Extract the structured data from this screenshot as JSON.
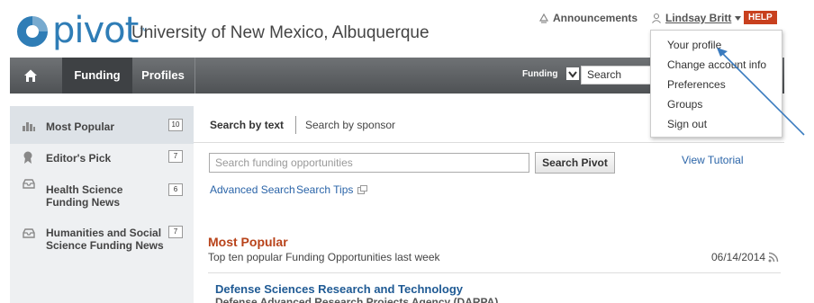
{
  "header": {
    "logo_text": "pivot",
    "logo_tm": "™",
    "institution": "University of New Mexico, Albuquerque",
    "announcements": "Announcements",
    "user_name": "Lindsay Britt",
    "help": "HELP"
  },
  "nav": {
    "tabs": [
      "Funding",
      "Profiles"
    ],
    "search_scope": "Funding",
    "search_placeholder": "Search"
  },
  "user_menu": {
    "items": [
      "Your profile",
      "Change account info",
      "Preferences",
      "Groups",
      "Sign out"
    ]
  },
  "sidebar": {
    "items": [
      {
        "label": "Most Popular",
        "count": "10"
      },
      {
        "label": "Editor's Pick",
        "count": "7"
      },
      {
        "label": "Health Science Funding News",
        "count": "6"
      },
      {
        "label": "Humanities and Social Science Funding News",
        "count": "7"
      }
    ]
  },
  "main": {
    "tab_search_text": "Search by text",
    "tab_search_sponsor": "Search by sponsor",
    "search_placeholder": "Search funding opportunities",
    "search_button": "Search Pivot",
    "advanced_search": "Advanced Search",
    "search_tips": "Search Tips",
    "view_tutorial": "View Tutorial",
    "section_title": "Most Popular",
    "section_subtitle": "Top ten popular Funding Opportunities last week",
    "section_date": "06/14/2014",
    "first_result_title": "Defense Sciences Research and Technology",
    "first_result_sponsor": "Defense Advanced Research Projects Agency (DARPA)"
  },
  "colors": {
    "brand_blue": "#2f7db6",
    "nav_gray": "#5a5d60",
    "accent_orange": "#b8431a",
    "help_red": "#c8401e",
    "link_blue": "#2a64a8",
    "annotation_arrow": "#3a7bbf"
  }
}
